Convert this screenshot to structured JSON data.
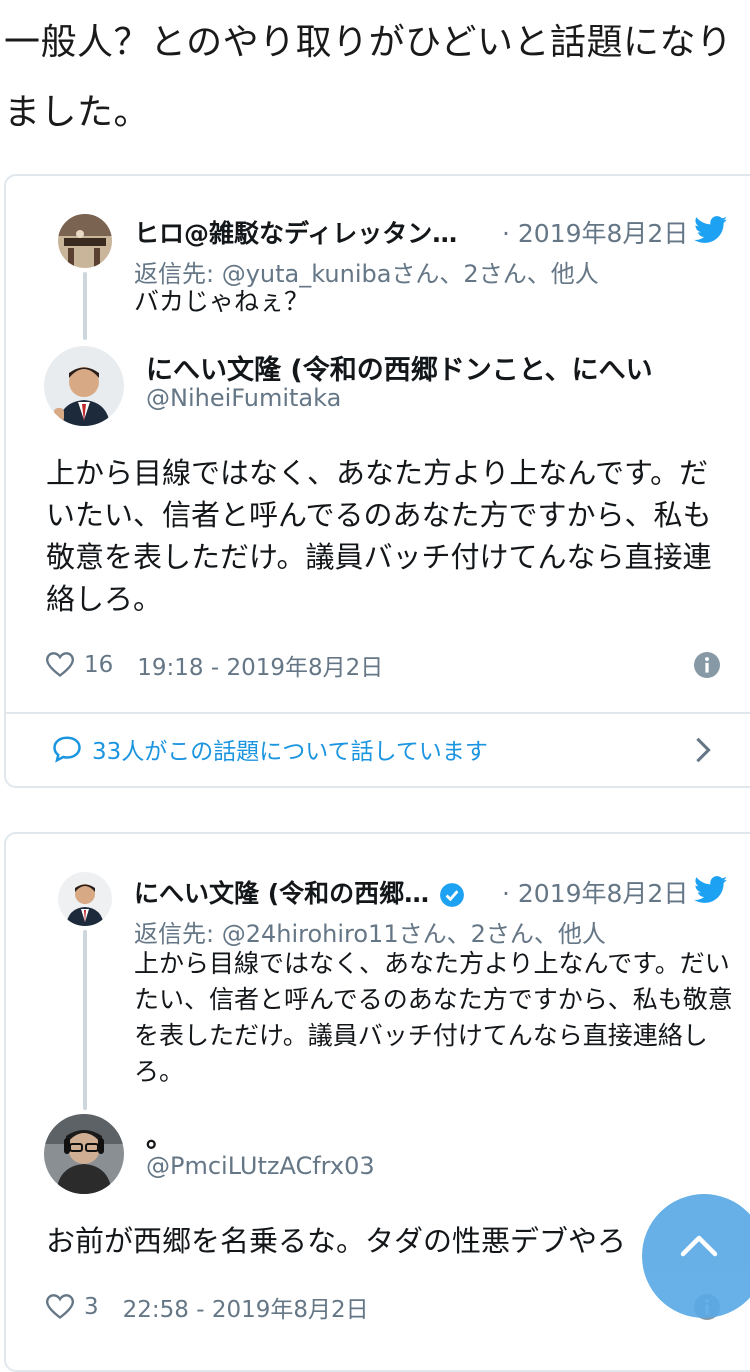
{
  "intro": "一般人？とのやり取りがひどいと話題になりました。",
  "card1": {
    "parent": {
      "name": "ヒロ@雑駁なディレッタン…",
      "date": "· 2019年8月2日",
      "replying": "返信先: @yuta_kunibaさん、2さん、他人",
      "text": "バカじゃねぇ？"
    },
    "main": {
      "name": "にへい文隆 (令和の西郷ドンこと、にへい",
      "handle": "@NiheiFumitaka",
      "text": "上から目線ではなく、あなた方より上なんです。だいたい、信者と呼んでるのあなた方ですから、私も敬意を表しただけ。議員バッチ付けてんなら直接連絡しろ。",
      "likes": "16",
      "time": "19:18 - 2019年8月2日"
    },
    "conversation": "33人がこの話題について話しています"
  },
  "card2": {
    "parent": {
      "name": "にへい文隆 (令和の西郷…",
      "date": "· 2019年8月2日",
      "replying": "返信先: @24hirohiro11さん、2さん、他人",
      "text": "上から目線ではなく、あなた方より上なんです。だいたい、信者と呼んでるのあなた方ですから、私も敬意を表しただけ。議員バッチ付けてんなら直接連絡しろ。"
    },
    "main": {
      "name": "。",
      "handle": "@PmciLUtzACfrx03",
      "text": "お前が西郷を名乗るな。タダの性悪デブやろ",
      "likes": "3",
      "time": "22:58 - 2019年8月2日"
    }
  },
  "colors": {
    "twitter_blue": "#1da1f2",
    "link_blue": "#1b95e0",
    "secondary": "#657786",
    "border": "#e1e8ed",
    "fab": "#5aa9e6"
  },
  "icons": [
    "twitter-bird-icon",
    "heart-icon",
    "info-icon",
    "speech-bubble-icon",
    "chevron-right-icon",
    "verified-badge-icon",
    "chevron-up-icon"
  ]
}
